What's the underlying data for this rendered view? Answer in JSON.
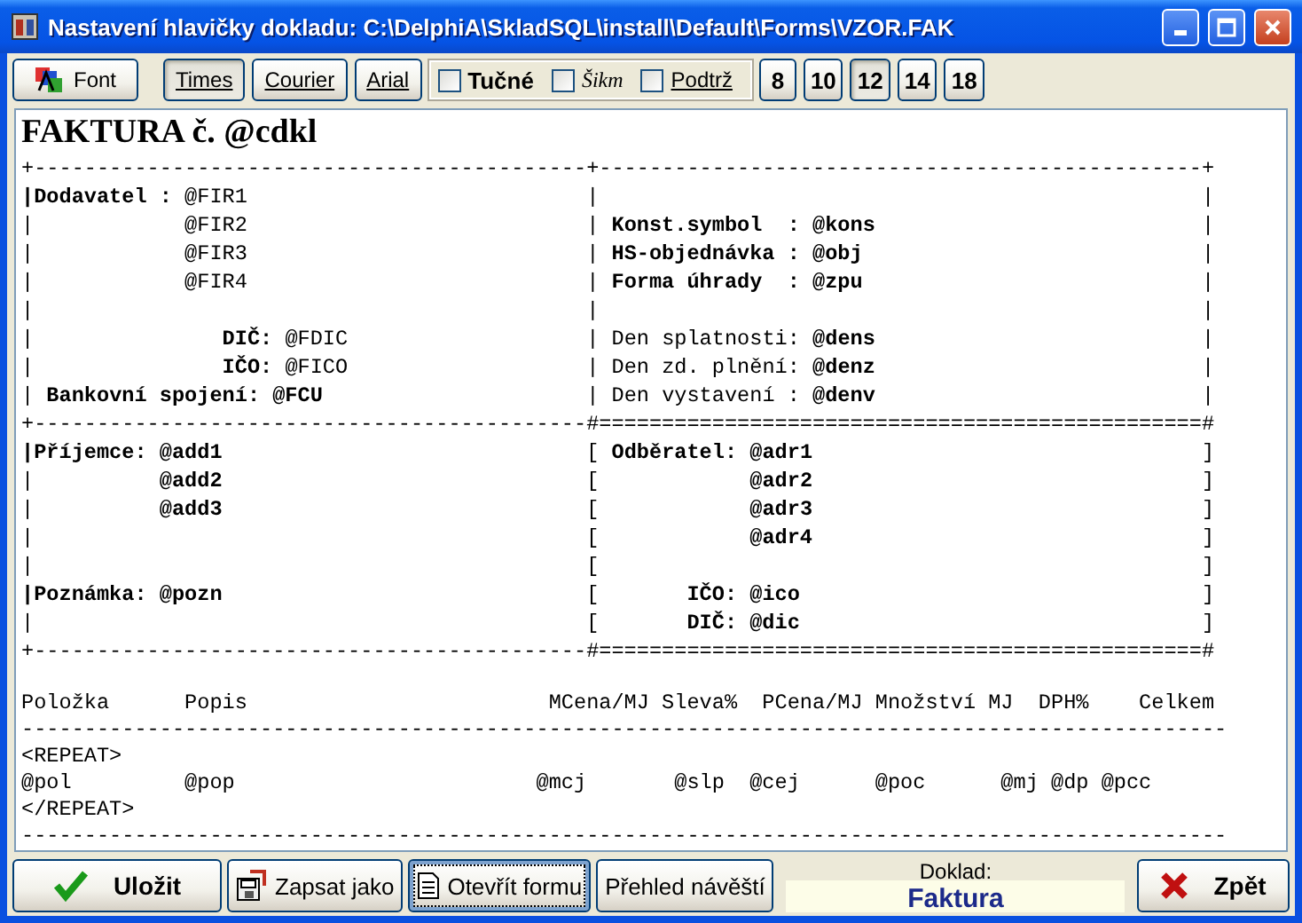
{
  "window": {
    "title": "Nastavení hlavičky dokladu: C:\\DelphiA\\SkladSQL\\install\\Default\\Forms\\VZOR.FAK"
  },
  "toolbar": {
    "font_button": "Font",
    "fonts": [
      {
        "label": "Times",
        "selected": true
      },
      {
        "label": "Courier",
        "selected": false
      },
      {
        "label": "Arial",
        "selected": false
      }
    ],
    "styles": [
      {
        "kind": "bold",
        "label": "Tučné",
        "checked": false
      },
      {
        "kind": "italic",
        "label": "Šikm",
        "checked": false
      },
      {
        "kind": "underline",
        "label": "Podtrž",
        "checked": false
      }
    ],
    "sizes": [
      {
        "label": "8",
        "selected": false
      },
      {
        "label": "10",
        "selected": false
      },
      {
        "label": "12",
        "selected": true
      },
      {
        "label": "14",
        "selected": false
      },
      {
        "label": "18",
        "selected": false
      }
    ]
  },
  "editor": {
    "title": "FAKTURA č. @cdkl",
    "box_lines": [
      "+--------------------------------------------+------------------------------------------------+",
      "**|Dodavatel :** @FIR1                           |                                                |",
      "|            @FIR2                           | **Konst.symbol  : @kons**                          |",
      "|            @FIR3                           | **HS-objednávka : @obj**                           |",
      "|            @FIR4                           | **Forma úhrady  : @zpu**                           |",
      "|                                            |                                                |",
      "|               **DIČ:** @FDIC                   | Den splatnosti: **@dens**                          |",
      "|               **IČO:** @FICO                   | Den zd. plnění: **@denz**                          |",
      "| **Bankovní spojení: @FCU**                     | Den vystavení : **@denv**                          |",
      "+--------------------------------------------#================================================#",
      "**|Příjemce: @add1**                             [ **Odběratel: @adr1**                               ]",
      "|          **@add2**                             [            **@adr2**                               ]",
      "|          **@add3**                             [            **@adr3**                               ]",
      "|                                            [            **@adr4**                               ]",
      "|                                            [                                                ]",
      "**|Poznámka: @pozn**                             [       **IČO: @ico**                                ]",
      "|                                            [       **DIČ: @dic**                                ]",
      "+--------------------------------------------#================================================#"
    ],
    "table_lines": [
      "Položka      Popis                        MCena/MJ Sleva%  PCena/MJ Množství MJ  DPH%    Celkem",
      "------------------------------------------------------------------------------------------------",
      "<REPEAT>",
      "@pol         @pop                        @mcj       @slp  @cej      @poc      @mj @dp @pcc",
      "</REPEAT>",
      "------------------------------------------------------------------------------------------------"
    ]
  },
  "footer": {
    "buttons": [
      {
        "kind": "save",
        "label": "Uložit",
        "focused": false
      },
      {
        "kind": "save_as",
        "label": "Zapsat jako",
        "focused": false
      },
      {
        "kind": "open",
        "label": "Otevřít formu",
        "focused": true
      },
      {
        "kind": "overview",
        "label": "Přehled návěští",
        "focused": false
      }
    ],
    "document_caption": "Doklad:",
    "document_type": "Faktura",
    "back_button": "Zpět"
  }
}
